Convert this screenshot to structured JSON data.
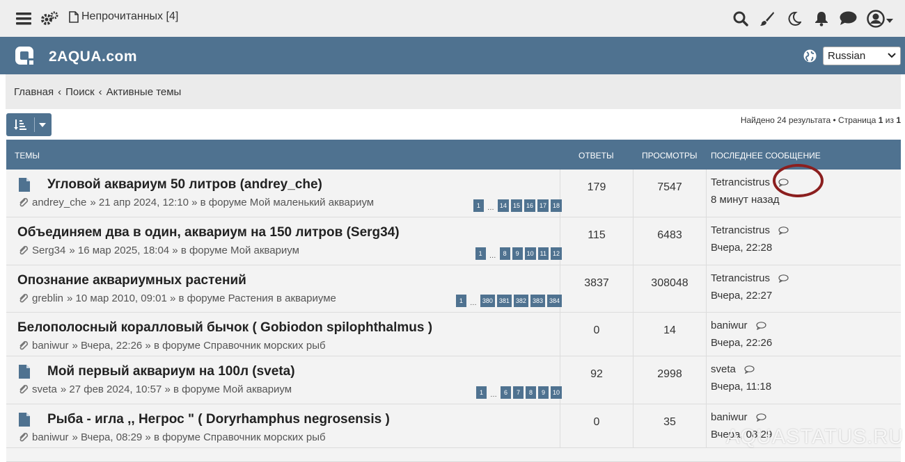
{
  "topbar": {
    "unread_label": "Непрочитанных [4]",
    "icons": [
      "menu-icon",
      "gears-icon",
      "document-icon",
      "search-icon",
      "brush-icon",
      "moon-icon",
      "bell-icon",
      "chat-icon",
      "user-icon"
    ]
  },
  "header": {
    "site_title": "2AQUA.com",
    "language": "Russian"
  },
  "breadcrumbs": [
    "Главная",
    "‹",
    "Поиск",
    "‹",
    "Активные темы"
  ],
  "results": {
    "text_before": "Найдено 24 результата • Страница ",
    "page": "1",
    "of": " из ",
    "total": "1"
  },
  "table": {
    "headers": {
      "topics": "ТЕМЫ",
      "replies": "ОТВЕТЫ",
      "views": "ПРОСМОТРЫ",
      "last": "ПОСЛЕДНЕЕ СООБЩЕНИЕ"
    },
    "rows": [
      {
        "title": "Угловой аквариум 50 литров (andrey_che)",
        "has_icon": true,
        "author": "andrey_che",
        "meta": "» 21 апр 2024, 12:10 » в форуме Мой маленький аквариум",
        "pages": [
          "1",
          "…",
          "14",
          "15",
          "16",
          "17",
          "18"
        ],
        "replies": "179",
        "views": "7547",
        "last_user": "Tetrancistrus",
        "last_time": "8 минут назад"
      },
      {
        "title": "Объединяем два в один, аквариум на 150 литров (Serg34)",
        "has_icon": false,
        "author": "Serg34",
        "meta": "» 16 мар 2025, 18:04 » в форуме Мой аквариум",
        "pages": [
          "1",
          "…",
          "8",
          "9",
          "10",
          "11",
          "12"
        ],
        "replies": "115",
        "views": "6483",
        "last_user": "Tetrancistrus",
        "last_time": "Вчера, 22:28"
      },
      {
        "title": "Опознание аквариумных растений",
        "has_icon": false,
        "author": "greblin",
        "meta": "» 10 мар 2010, 09:01 » в форуме Растения в аквариуме",
        "pages": [
          "1",
          "…",
          "380",
          "381",
          "382",
          "383",
          "384"
        ],
        "replies": "3837",
        "views": "308048",
        "last_user": "Tetrancistrus",
        "last_time": "Вчера, 22:27"
      },
      {
        "title": "Белополосный коралловый бычок ( Gobiodon spilophthalmus )",
        "has_icon": false,
        "author": "baniwur",
        "meta": "» Вчера, 22:26 » в форуме Справочник морских рыб",
        "pages": [],
        "replies": "0",
        "views": "14",
        "last_user": "baniwur",
        "last_time": "Вчера, 22:26"
      },
      {
        "title": "Мой первый аквариум на 100л (sveta)",
        "has_icon": true,
        "author": "sveta",
        "meta": "» 27 фев 2024, 10:57 » в форуме Мой аквариум",
        "pages": [
          "1",
          "…",
          "6",
          "7",
          "8",
          "9",
          "10"
        ],
        "replies": "92",
        "views": "2998",
        "last_user": "sveta",
        "last_time": "Вчера, 11:18"
      },
      {
        "title": "Рыба - игла ,, Негрос \" ( Doryrhamphus negrosensis )",
        "has_icon": true,
        "author": "baniwur",
        "meta": "» Вчера, 08:29 » в форуме Справочник морских рыб",
        "pages": [],
        "replies": "0",
        "views": "35",
        "last_user": "baniwur",
        "last_time": "Вчера, 08:29"
      }
    ]
  },
  "watermark": "AQUASTATUS.RU",
  "colors": {
    "accent": "#4f7290",
    "annotation": "#8b1f1f"
  }
}
